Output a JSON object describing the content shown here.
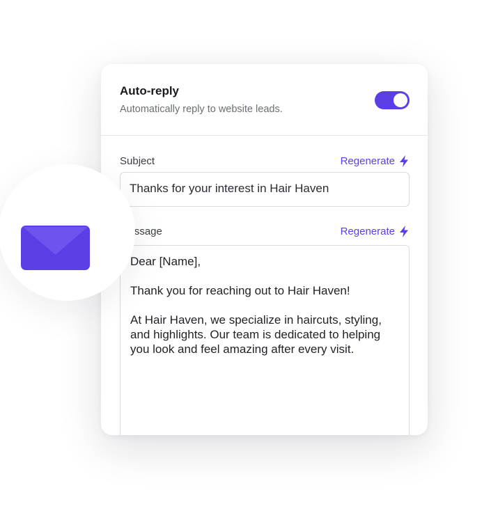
{
  "autoreply": {
    "title": "Auto-reply",
    "description": "Automatically reply to website leads.",
    "enabled": true
  },
  "subject": {
    "label": "Subject",
    "regenerate_label": "Regenerate",
    "value": "Thanks for your interest in Hair Haven"
  },
  "message": {
    "label": "Message",
    "regenerate_label": "Regenerate",
    "paragraphs": [
      "Dear [Name],",
      "Thank you for reaching out to Hair Haven!",
      "At Hair Haven, we specialize in haircuts, styling, and highlights. Our team is dedicated to helping you look and feel amazing after every visit."
    ]
  },
  "icons": {
    "envelope": "envelope-icon",
    "regenerate": "lightning-bolt-icon"
  },
  "colors": {
    "accent": "#5b3ee6",
    "envelope": "#5b3ee6"
  }
}
